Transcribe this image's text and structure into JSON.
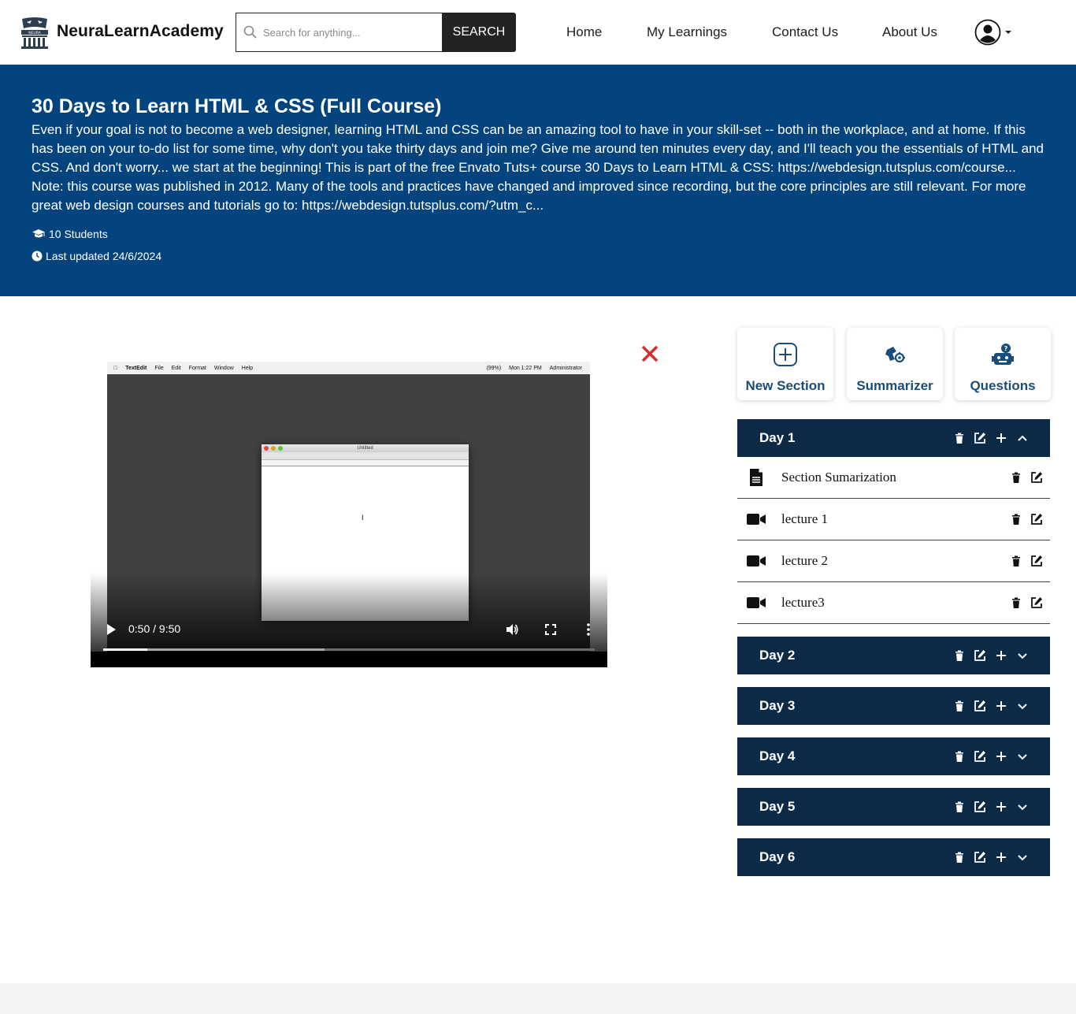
{
  "brand": {
    "name": "NeuraLearnAcademy",
    "logo_text": "NEURA"
  },
  "search": {
    "placeholder": "Search for anything...",
    "button_label": "SEARCH"
  },
  "nav": {
    "home": "Home",
    "my_learnings": "My Learnings",
    "contact": "Contact Us",
    "about": "About Us"
  },
  "course": {
    "title": "30 Days to Learn HTML & CSS (Full Course)",
    "description": "Even if your goal is not to become a web designer, learning HTML and CSS can be an amazing tool to have in your skill-set -- both in the workplace, and at home. If this has been on your to-do list for some time, why don't you take thirty days and join me? Give me around ten minutes every day, and I'll teach you the essentials of HTML and CSS. And don't worry... we start at the beginning! This is part of the free Envato Tuts+ course 30 Days to Learn HTML & CSS: https://webdesign.tutsplus.com/course... Note: this course was published in 2012. Many of the tools and practices have changed and improved since recording, but the core principles are still relevant. For more great web design courses and tutorials go to: https://webdesign.tutsplus.com/?utm_c...",
    "students": "10 Students",
    "last_updated": "Last updated 24/6/2024"
  },
  "video": {
    "time": "0:50 / 9:50",
    "progress": 0.09,
    "buffered": 0.45,
    "screen": {
      "menu_items": [
        "TextEdit",
        "File",
        "Edit",
        "Format",
        "Window",
        "Help"
      ],
      "clock": "Mon 1:22 PM",
      "user": "Administrator",
      "battery": "(99%)",
      "window_title": "Untitled"
    }
  },
  "tools": {
    "new_section": "New Section",
    "summarizer": "Summarizer",
    "questions": "Questions"
  },
  "sections": [
    {
      "title": "Day 1",
      "expanded": true
    },
    {
      "title": "Day 2",
      "expanded": false
    },
    {
      "title": "Day 3",
      "expanded": false
    },
    {
      "title": "Day 4",
      "expanded": false
    },
    {
      "title": "Day 5",
      "expanded": false
    },
    {
      "title": "Day 6",
      "expanded": false
    }
  ],
  "day1_items": [
    {
      "type": "document",
      "title": "Section Sumarization"
    },
    {
      "type": "video",
      "title": "lecture 1"
    },
    {
      "type": "video",
      "title": "lecture 2"
    },
    {
      "type": "video",
      "title": "lecture3"
    }
  ],
  "colors": {
    "hero": "#03447f",
    "section_header": "#0c2a46",
    "tool_label": "#1a4d7a",
    "close": "#d32f2f"
  },
  "icons": {
    "students": "graduation-cap-icon",
    "updated": "clock-icon",
    "delete": "trash-icon",
    "edit": "edit-icon",
    "add": "plus-icon",
    "expand": "chevron-down-icon",
    "collapse": "chevron-up-icon"
  }
}
